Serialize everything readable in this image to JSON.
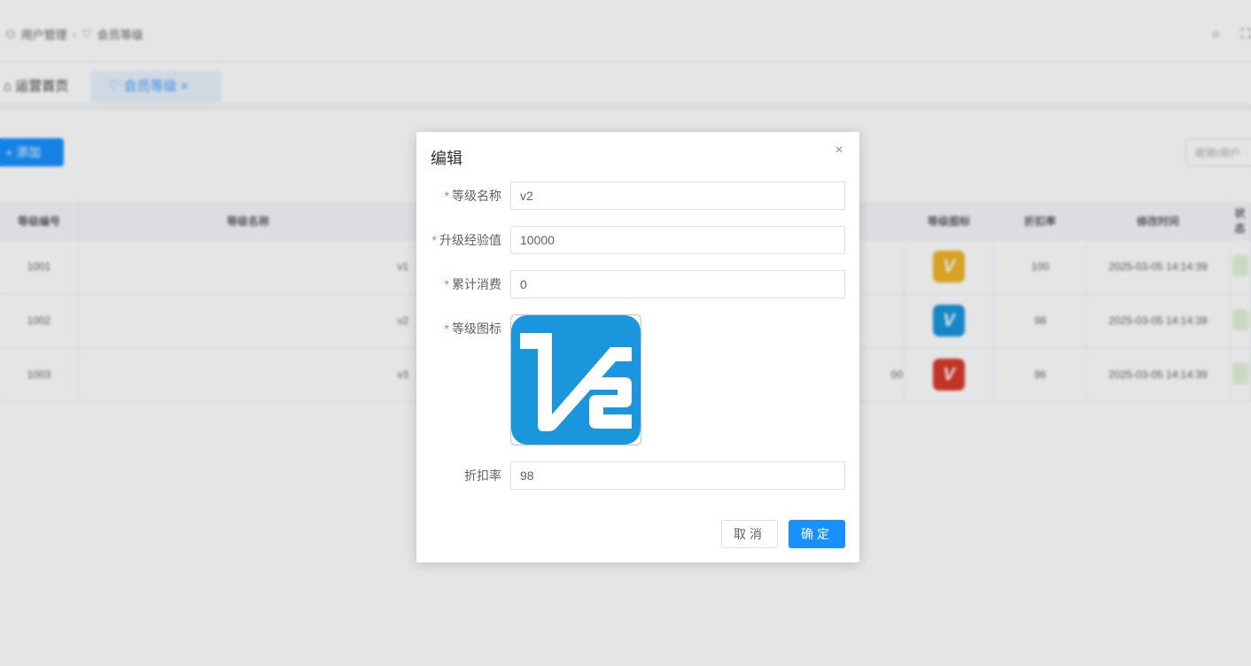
{
  "breadcrumb": {
    "parent": "用户管理",
    "current": "会员等级"
  },
  "tabs": {
    "home": "运营首页",
    "active": "会员等级"
  },
  "toolbar": {
    "add_label": "+ 添加",
    "search_placeholder": "昵称/用户"
  },
  "table": {
    "headers": [
      "等级编号",
      "等级名称",
      "",
      "等级图标",
      "折扣率",
      "修改时间",
      "状态"
    ],
    "rows": [
      {
        "id": "1001",
        "name": "v1",
        "extra": "",
        "icon_text": "V",
        "icon_color": "#f0b429",
        "discount": "100",
        "time": "2025-03-05 14:14:39"
      },
      {
        "id": "1002",
        "name": "v2",
        "extra": "",
        "icon_text": "V",
        "icon_color": "#1a96dc",
        "discount": "98",
        "time": "2025-03-05 14:14:39"
      },
      {
        "id": "1003",
        "name": "v3",
        "extra": "00",
        "icon_text": "V",
        "icon_color": "#d93a2b",
        "discount": "96",
        "time": "2025-03-05 14:14:39"
      }
    ]
  },
  "dialog": {
    "title": "编辑",
    "close_symbol": "×",
    "fields": {
      "level_name": {
        "label": "等级名称",
        "value": "v2",
        "required": true
      },
      "upgrade_exp": {
        "label": "升级经验值",
        "value": "10000",
        "required": true
      },
      "total_spend": {
        "label": "累计消费",
        "value": "0",
        "required": true
      },
      "level_icon": {
        "label": "等级图标",
        "required": true
      },
      "discount": {
        "label": "折扣率",
        "value": "98",
        "required": false
      }
    },
    "icon_color": "#1a96dc",
    "cancel_label": "取消",
    "ok_label": "确定"
  },
  "colors": {
    "primary": "#1890ff",
    "required": "#f56c6c"
  }
}
